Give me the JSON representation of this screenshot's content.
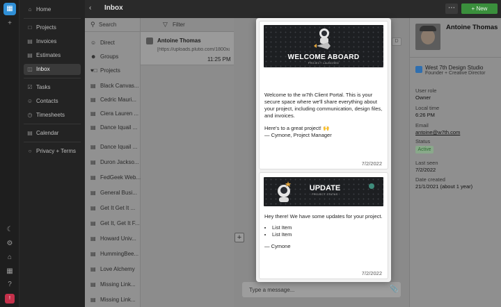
{
  "app": {
    "title": "Inbox",
    "accent": "#3a8f3c"
  },
  "rail": {
    "icons": [
      "app-logo-icon",
      "add-icon",
      "moon-icon",
      "gear-icon",
      "home-icon",
      "apps-icon",
      "help-icon"
    ],
    "avatar_initial": "!"
  },
  "nav": {
    "items": [
      {
        "label": "Home",
        "icon": "home-icon"
      },
      {
        "label": "Projects",
        "icon": "folder-icon"
      },
      {
        "label": "Invoices",
        "icon": "invoice-icon"
      },
      {
        "label": "Estimates",
        "icon": "estimate-icon"
      },
      {
        "label": "Inbox",
        "icon": "inbox-icon"
      },
      {
        "label": "Tasks",
        "icon": "tasks-icon"
      },
      {
        "label": "Contacts",
        "icon": "contacts-icon"
      },
      {
        "label": "Timesheets",
        "icon": "clock-icon"
      },
      {
        "label": "Calendar",
        "icon": "calendar-icon"
      },
      {
        "label": "Privacy + Terms",
        "icon": "shield-icon"
      }
    ]
  },
  "topbar": {
    "new_label": "New",
    "new_icon": "+",
    "more_label": "⋯"
  },
  "list": {
    "search_placeholder": "Search",
    "items": [
      "Direct",
      "Groups",
      "Projects",
      "Black Canvas...",
      "Cedric Mauri...",
      "Ciera Lauren ...",
      "Dance Iquail ...",
      "Dance Iquail ...",
      "Duron Jackso...",
      "FedGeek Web...",
      "General Busi...",
      "Get It Get It ...",
      "Get It, Get It F...",
      "Howard Univ...",
      "HummingBee...",
      "Love Alchemy",
      "Missing Link...",
      "Missing Link..."
    ]
  },
  "thread": {
    "filter_label": "Filter",
    "card": {
      "name": "Antoine Thomas",
      "preview": "[https://uploads.plutio.com/1800xautc",
      "time": "11:25 PM"
    }
  },
  "conversation": {
    "compose_placeholder": "Type a message...",
    "side_tab": "D"
  },
  "messages": [
    {
      "banner_title": "WELCOME ABOARD",
      "banner_subtitle": "PROJECT LAUNCHED",
      "paragraph1": "Welcome to the w7th Client Portal. This is your secure space where we'll share everything about your project, including communication, design files, and invoices.",
      "paragraph2": "Here's to a great project! 🙌",
      "signature": "— Cymone, Project Manager",
      "date": "7/2/2022"
    },
    {
      "banner_title": "UPDATE",
      "banner_subtitle": "PROJECT STATUS",
      "paragraph1": "Hey there! We have some updates for your project.",
      "list_items": [
        "List Item",
        "List Item"
      ],
      "signature": "— Cymone",
      "date": "7/2/2022"
    }
  ],
  "details": {
    "name": "Antoine Thomas",
    "org": "West 7th Design Studio",
    "role": "Founder + Creative Director",
    "fields": [
      {
        "label": "User role",
        "value": "Owner"
      },
      {
        "label": "Local time",
        "value": "6:26 PM"
      },
      {
        "label": "Email",
        "value": "antoine@w7th.com"
      },
      {
        "label": "Status",
        "value": "Active"
      },
      {
        "label": "Last seen",
        "value": "7/2/2022"
      },
      {
        "label": "Date created",
        "value": "21/1/2021 (about 1 year)"
      }
    ]
  }
}
